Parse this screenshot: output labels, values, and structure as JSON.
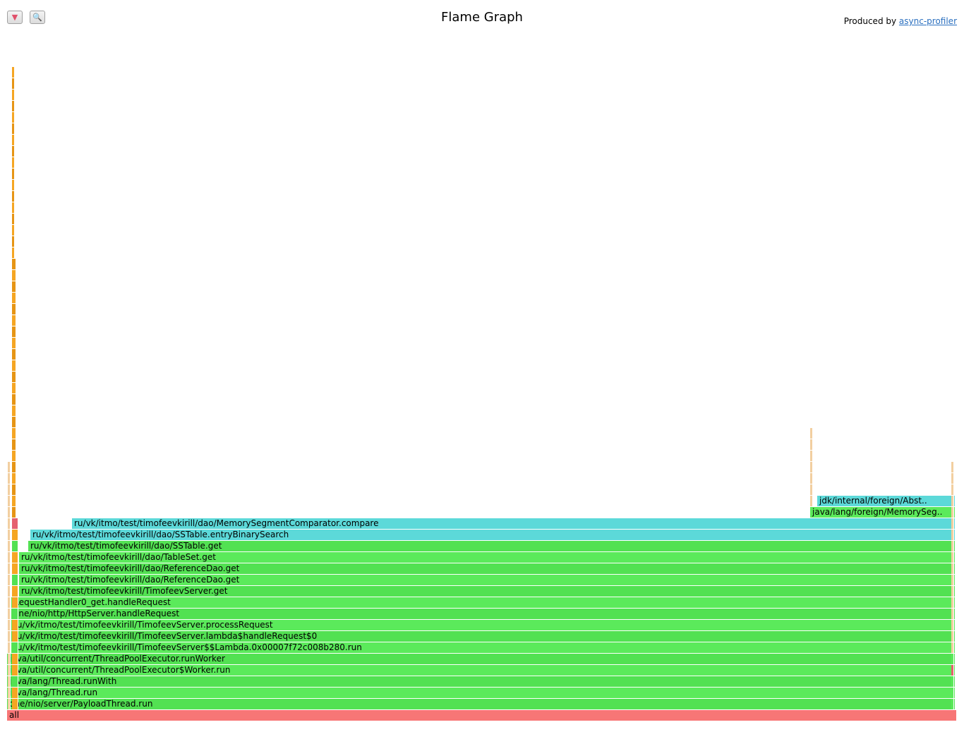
{
  "toolbar": {
    "reverse_icon": "▼",
    "search_icon": "🔍"
  },
  "header": {
    "title": "Flame Graph",
    "produced_prefix": "Produced by ",
    "produced_link": "async-profiler"
  },
  "colors": {
    "java": "#5bea5b",
    "java_alt": "#52e152",
    "inlined": "#5cd9d9",
    "native": "#f77676",
    "native_alt": "#e5606e",
    "kernel": "#f5a623",
    "kernel_alt": "#e69515",
    "faint": "#f2cfa0"
  },
  "frames": [
    {
      "label": "all",
      "level": 0,
      "start": 0,
      "end": 1,
      "color": "native"
    },
    {
      "label": "one/nio/server/PayloadThread.run",
      "level": 1,
      "start": 0,
      "end": 0.9985,
      "color": "java_alt"
    },
    {
      "label": "java/lang/Thread.run",
      "level": 2,
      "start": 0,
      "end": 0.9985,
      "color": "java"
    },
    {
      "label": "java/lang/Thread.runWith",
      "level": 3,
      "start": 0,
      "end": 0.9985,
      "color": "java_alt"
    },
    {
      "label": "java/util/concurrent/ThreadPoolExecutor$Worker.run",
      "level": 4,
      "start": 0,
      "end": 0.9985,
      "color": "java"
    },
    {
      "label": "java/util/concurrent/ThreadPoolExecutor.runWorker",
      "level": 5,
      "start": 0,
      "end": 0.9985,
      "color": "java_alt"
    },
    {
      "label": "ru/vk/itmo/test/timofeevkirill/TimofeevServer$$Lambda.0x00007f72c008b280.run",
      "level": 6,
      "start": 0.0045,
      "end": 0.9985,
      "color": "java"
    },
    {
      "label": "ru/vk/itmo/test/timofeevkirill/TimofeevServer.lambda$handleRequest$0",
      "level": 7,
      "start": 0.0045,
      "end": 0.9985,
      "color": "java_alt"
    },
    {
      "label": "ru/vk/itmo/test/timofeevkirill/TimofeevServer.processRequest",
      "level": 8,
      "start": 0.0045,
      "end": 0.9985,
      "color": "java"
    },
    {
      "label": "one/nio/http/HttpServer.handleRequest",
      "level": 9,
      "start": 0.0045,
      "end": 0.9985,
      "color": "java_alt"
    },
    {
      "label": "RequestHandler0_get.handleRequest",
      "level": 10,
      "start": 0.0045,
      "end": 0.9985,
      "color": "java"
    },
    {
      "label": "ru/vk/itmo/test/timofeevkirill/TimofeevServer.get",
      "level": 11,
      "start": 0.0125,
      "end": 0.9985,
      "color": "java_alt"
    },
    {
      "label": "ru/vk/itmo/test/timofeevkirill/dao/ReferenceDao.get",
      "level": 12,
      "start": 0.0125,
      "end": 0.9985,
      "color": "java"
    },
    {
      "label": "ru/vk/itmo/test/timofeevkirill/dao/ReferenceDao.get",
      "level": 13,
      "start": 0.0125,
      "end": 0.9985,
      "color": "java_alt"
    },
    {
      "label": "ru/vk/itmo/test/timofeevkirill/dao/TableSet.get",
      "level": 14,
      "start": 0.0125,
      "end": 0.9985,
      "color": "java"
    },
    {
      "label": "ru/vk/itmo/test/timofeevkirill/dao/SSTable.get",
      "level": 15,
      "start": 0.022,
      "end": 0.9985,
      "color": "java_alt"
    },
    {
      "label": "ru/vk/itmo/test/timofeevkirill/dao/SSTable.entryBinarySearch",
      "level": 16,
      "start": 0.0245,
      "end": 0.9985,
      "color": "inlined"
    },
    {
      "label": "ru/vk/itmo/test/timofeevkirill/dao/MemorySegmentComparator.compare",
      "level": 17,
      "start": 0.068,
      "end": 0.9985,
      "color": "inlined"
    },
    {
      "label": "java/lang/foreign/MemorySeg..",
      "level": 18,
      "start": 0.8455,
      "end": 0.9985,
      "color": "java"
    },
    {
      "label": "jdk/internal/foreign/Abst..",
      "level": 19,
      "start": 0.853,
      "end": 0.9985,
      "color": "inlined"
    }
  ]
}
